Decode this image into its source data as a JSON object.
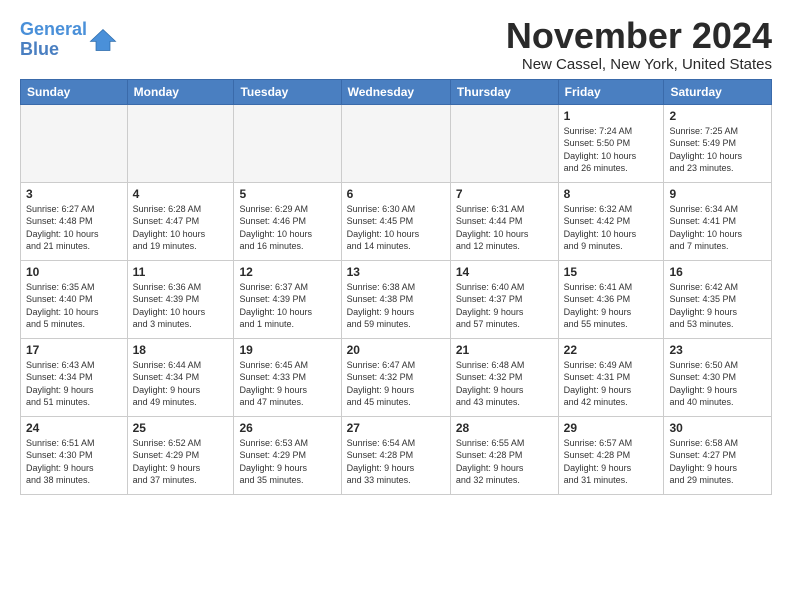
{
  "logo": {
    "line1": "General",
    "line2": "Blue"
  },
  "title": "November 2024",
  "location": "New Cassel, New York, United States",
  "weekdays": [
    "Sunday",
    "Monday",
    "Tuesday",
    "Wednesday",
    "Thursday",
    "Friday",
    "Saturday"
  ],
  "weeks": [
    [
      {
        "day": "",
        "info": ""
      },
      {
        "day": "",
        "info": ""
      },
      {
        "day": "",
        "info": ""
      },
      {
        "day": "",
        "info": ""
      },
      {
        "day": "",
        "info": ""
      },
      {
        "day": "1",
        "info": "Sunrise: 7:24 AM\nSunset: 5:50 PM\nDaylight: 10 hours\nand 26 minutes."
      },
      {
        "day": "2",
        "info": "Sunrise: 7:25 AM\nSunset: 5:49 PM\nDaylight: 10 hours\nand 23 minutes."
      }
    ],
    [
      {
        "day": "3",
        "info": "Sunrise: 6:27 AM\nSunset: 4:48 PM\nDaylight: 10 hours\nand 21 minutes."
      },
      {
        "day": "4",
        "info": "Sunrise: 6:28 AM\nSunset: 4:47 PM\nDaylight: 10 hours\nand 19 minutes."
      },
      {
        "day": "5",
        "info": "Sunrise: 6:29 AM\nSunset: 4:46 PM\nDaylight: 10 hours\nand 16 minutes."
      },
      {
        "day": "6",
        "info": "Sunrise: 6:30 AM\nSunset: 4:45 PM\nDaylight: 10 hours\nand 14 minutes."
      },
      {
        "day": "7",
        "info": "Sunrise: 6:31 AM\nSunset: 4:44 PM\nDaylight: 10 hours\nand 12 minutes."
      },
      {
        "day": "8",
        "info": "Sunrise: 6:32 AM\nSunset: 4:42 PM\nDaylight: 10 hours\nand 9 minutes."
      },
      {
        "day": "9",
        "info": "Sunrise: 6:34 AM\nSunset: 4:41 PM\nDaylight: 10 hours\nand 7 minutes."
      }
    ],
    [
      {
        "day": "10",
        "info": "Sunrise: 6:35 AM\nSunset: 4:40 PM\nDaylight: 10 hours\nand 5 minutes."
      },
      {
        "day": "11",
        "info": "Sunrise: 6:36 AM\nSunset: 4:39 PM\nDaylight: 10 hours\nand 3 minutes."
      },
      {
        "day": "12",
        "info": "Sunrise: 6:37 AM\nSunset: 4:39 PM\nDaylight: 10 hours\nand 1 minute."
      },
      {
        "day": "13",
        "info": "Sunrise: 6:38 AM\nSunset: 4:38 PM\nDaylight: 9 hours\nand 59 minutes."
      },
      {
        "day": "14",
        "info": "Sunrise: 6:40 AM\nSunset: 4:37 PM\nDaylight: 9 hours\nand 57 minutes."
      },
      {
        "day": "15",
        "info": "Sunrise: 6:41 AM\nSunset: 4:36 PM\nDaylight: 9 hours\nand 55 minutes."
      },
      {
        "day": "16",
        "info": "Sunrise: 6:42 AM\nSunset: 4:35 PM\nDaylight: 9 hours\nand 53 minutes."
      }
    ],
    [
      {
        "day": "17",
        "info": "Sunrise: 6:43 AM\nSunset: 4:34 PM\nDaylight: 9 hours\nand 51 minutes."
      },
      {
        "day": "18",
        "info": "Sunrise: 6:44 AM\nSunset: 4:34 PM\nDaylight: 9 hours\nand 49 minutes."
      },
      {
        "day": "19",
        "info": "Sunrise: 6:45 AM\nSunset: 4:33 PM\nDaylight: 9 hours\nand 47 minutes."
      },
      {
        "day": "20",
        "info": "Sunrise: 6:47 AM\nSunset: 4:32 PM\nDaylight: 9 hours\nand 45 minutes."
      },
      {
        "day": "21",
        "info": "Sunrise: 6:48 AM\nSunset: 4:32 PM\nDaylight: 9 hours\nand 43 minutes."
      },
      {
        "day": "22",
        "info": "Sunrise: 6:49 AM\nSunset: 4:31 PM\nDaylight: 9 hours\nand 42 minutes."
      },
      {
        "day": "23",
        "info": "Sunrise: 6:50 AM\nSunset: 4:30 PM\nDaylight: 9 hours\nand 40 minutes."
      }
    ],
    [
      {
        "day": "24",
        "info": "Sunrise: 6:51 AM\nSunset: 4:30 PM\nDaylight: 9 hours\nand 38 minutes."
      },
      {
        "day": "25",
        "info": "Sunrise: 6:52 AM\nSunset: 4:29 PM\nDaylight: 9 hours\nand 37 minutes."
      },
      {
        "day": "26",
        "info": "Sunrise: 6:53 AM\nSunset: 4:29 PM\nDaylight: 9 hours\nand 35 minutes."
      },
      {
        "day": "27",
        "info": "Sunrise: 6:54 AM\nSunset: 4:28 PM\nDaylight: 9 hours\nand 33 minutes."
      },
      {
        "day": "28",
        "info": "Sunrise: 6:55 AM\nSunset: 4:28 PM\nDaylight: 9 hours\nand 32 minutes."
      },
      {
        "day": "29",
        "info": "Sunrise: 6:57 AM\nSunset: 4:28 PM\nDaylight: 9 hours\nand 31 minutes."
      },
      {
        "day": "30",
        "info": "Sunrise: 6:58 AM\nSunset: 4:27 PM\nDaylight: 9 hours\nand 29 minutes."
      }
    ]
  ]
}
